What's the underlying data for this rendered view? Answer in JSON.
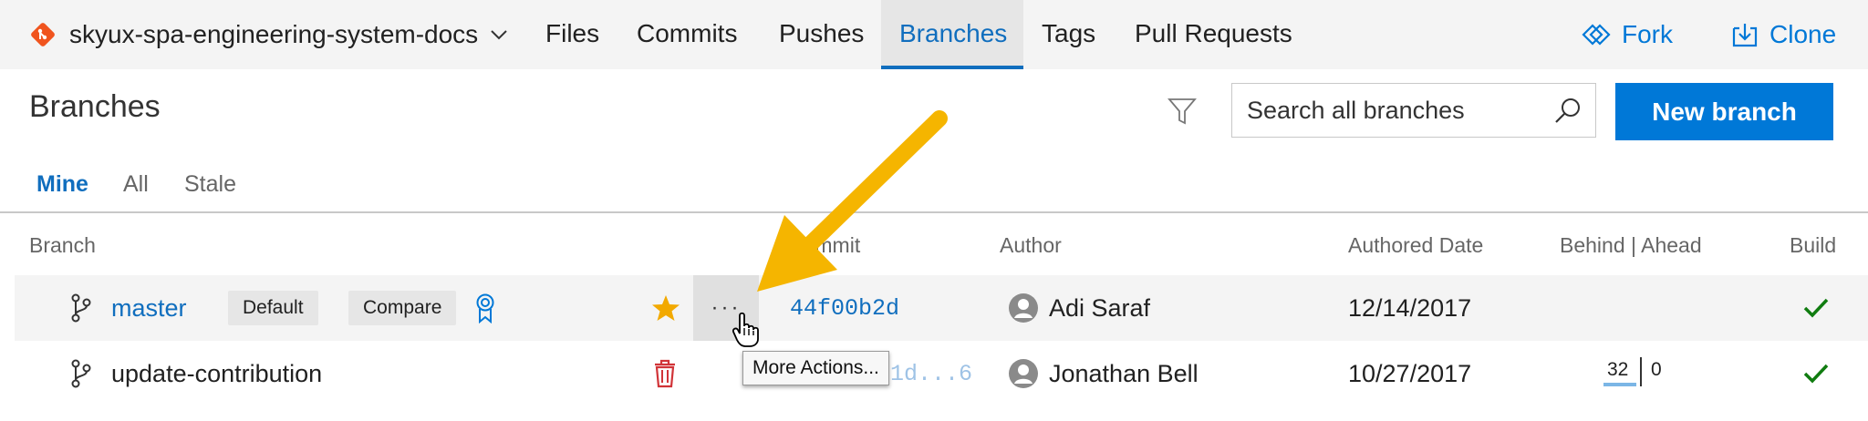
{
  "repo": {
    "name": "skyux-spa-engineering-system-docs",
    "icon": "git-diamond-icon",
    "icon_color": "#f0541e"
  },
  "nav": {
    "tabs": [
      {
        "label": "Files"
      },
      {
        "label": "Commits"
      },
      {
        "label": "Pushes"
      },
      {
        "label": "Branches",
        "active": true
      },
      {
        "label": "Tags"
      },
      {
        "label": "Pull Requests"
      }
    ],
    "actions": {
      "fork": "Fork",
      "clone": "Clone"
    }
  },
  "page": {
    "title": "Branches",
    "search_placeholder": "Search all branches",
    "new_branch_label": "New branch"
  },
  "pivots": [
    {
      "label": "Mine",
      "active": true
    },
    {
      "label": "All"
    },
    {
      "label": "Stale"
    }
  ],
  "columns": {
    "branch": "Branch",
    "commit": "Commit",
    "author": "Author",
    "date": "Authored Date",
    "behind_ahead": "Behind | Ahead",
    "build": "Build"
  },
  "rows": [
    {
      "branch": "master",
      "badge_default": "Default",
      "compare": "Compare",
      "favorite": true,
      "commit": "44f00b2d",
      "author": "Adi Saraf",
      "date": "12/14/2017",
      "behind": "",
      "ahead": "",
      "build_status": "succeeded"
    },
    {
      "branch": "update-contribution",
      "commit": "1d...6",
      "author": "Jonathan Bell",
      "date": "10/27/2017",
      "behind": "32",
      "ahead": "0",
      "build_status": "succeeded"
    }
  ],
  "more_actions": {
    "glyph": "···",
    "tooltip": "More Actions..."
  },
  "colors": {
    "accent": "#0078d7",
    "link": "#106ebe",
    "success": "#107c10",
    "favorite": "#f2a900",
    "delete": "#d13438",
    "annotation_arrow": "#f5b500"
  }
}
